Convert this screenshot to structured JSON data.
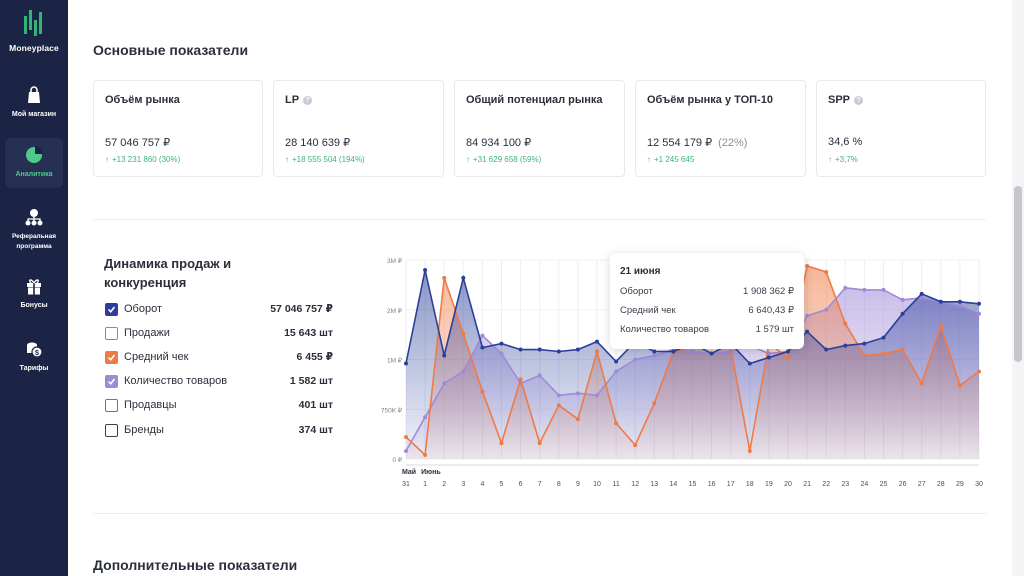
{
  "sidebar": {
    "logo_text": "Moneyplace",
    "items": [
      {
        "label": "Мой магазин",
        "icon": "bag-icon",
        "active": false
      },
      {
        "label": "Аналитика",
        "icon": "pie-chart-icon",
        "active": true
      },
      {
        "label": "Реферальная программа",
        "icon": "referral-network-icon",
        "active": false
      },
      {
        "label": "Бонусы",
        "icon": "gift-icon",
        "active": false
      },
      {
        "label": "Тарифы",
        "icon": "coins-icon",
        "active": false
      }
    ]
  },
  "main_title": "Основные показатели",
  "cards": [
    {
      "title": "Объём рынка",
      "value": "57 046 757 ₽",
      "pct": "",
      "delta": "+13 231 860 (30%)",
      "info": false
    },
    {
      "title": "LP",
      "value": "28 140 639 ₽",
      "pct": "",
      "delta": "+18 555 504 (194%)",
      "info": true
    },
    {
      "title": "Общий потенциал рынка",
      "value": "84 934 100 ₽",
      "pct": "",
      "delta": "+31 629 658 (59%)",
      "info": false
    },
    {
      "title": "Объём рынка у ТОП-10",
      "value": "12 554 179 ₽",
      "pct": "(22%)",
      "delta": "+1 245 645",
      "info": false
    },
    {
      "title": "SPP",
      "value": "34,6 %",
      "pct": "",
      "delta": "+3,7%",
      "info": true
    }
  ],
  "dynamics": {
    "title": "Динамика продаж и конкуренция",
    "legend": [
      {
        "label": "Оборот",
        "value": "57 046 757 ₽",
        "checked": true,
        "color": "#2b3f9a"
      },
      {
        "label": "Продажи",
        "value": "15 643 шт",
        "checked": false,
        "color": "#4fa98a"
      },
      {
        "label": "Средний чек",
        "value": "6 455 ₽",
        "checked": true,
        "color": "#f07a45"
      },
      {
        "label": "Количество товаров",
        "value": "1 582 шт",
        "checked": true,
        "color": "#a08ad8"
      },
      {
        "label": "Продавцы",
        "value": "401 шт",
        "checked": false,
        "color": "#b0596a"
      },
      {
        "label": "Бренды",
        "value": "374 шт",
        "checked": false,
        "color": "#3b404c"
      }
    ]
  },
  "tooltip": {
    "date": "21 июня",
    "rows": [
      {
        "label": "Оборот",
        "value": "1 908 362 ₽"
      },
      {
        "label": "Средний чек",
        "value": "6 640,43 ₽"
      },
      {
        "label": "Количество товаров",
        "value": "1 579 шт"
      }
    ]
  },
  "additional_title": "Дополнительные показатели",
  "chart_data": {
    "type": "area",
    "x": [
      "31",
      "1",
      "2",
      "3",
      "4",
      "5",
      "6",
      "7",
      "8",
      "9",
      "10",
      "11",
      "12",
      "13",
      "14",
      "15",
      "16",
      "17",
      "18",
      "19",
      "20",
      "21",
      "22",
      "23",
      "24",
      "25",
      "26",
      "27",
      "28",
      "29",
      "30"
    ],
    "month_labels": [
      "Май",
      "Июнь"
    ],
    "y_ticks": [
      "3M ₽",
      "2M ₽",
      "1M ₽",
      "750K ₽",
      "0 ₽"
    ],
    "grid": true,
    "series": [
      {
        "name": "Оборот",
        "color": "#2b3f9a",
        "values": [
          0.48,
          0.95,
          0.52,
          0.91,
          0.56,
          0.58,
          0.55,
          0.55,
          0.54,
          0.55,
          0.59,
          0.49,
          0.59,
          0.54,
          0.54,
          0.58,
          0.53,
          0.58,
          0.48,
          0.51,
          0.54,
          0.64,
          0.55,
          0.57,
          0.58,
          0.61,
          0.73,
          0.83,
          0.79,
          0.79,
          0.78
        ]
      },
      {
        "name": "Средний чек",
        "color": "#f07a45",
        "values": [
          0.11,
          0.02,
          0.91,
          0.63,
          0.34,
          0.08,
          0.4,
          0.08,
          0.27,
          0.2,
          0.54,
          0.18,
          0.07,
          0.28,
          0.54,
          0.56,
          0.58,
          0.56,
          0.04,
          0.58,
          0.51,
          0.97,
          0.94,
          0.68,
          0.52,
          0.53,
          0.55,
          0.38,
          0.67,
          0.37,
          0.44
        ]
      },
      {
        "name": "Количество товаров",
        "color": "#a08ad8",
        "values": [
          0.04,
          0.21,
          0.38,
          0.44,
          0.62,
          0.53,
          0.38,
          0.42,
          0.32,
          0.33,
          0.32,
          0.44,
          0.5,
          0.52,
          0.55,
          0.54,
          0.53,
          0.54,
          0.57,
          0.53,
          0.54,
          0.72,
          0.75,
          0.86,
          0.85,
          0.85,
          0.8,
          0.81,
          0.79,
          0.77,
          0.73
        ]
      }
    ]
  }
}
